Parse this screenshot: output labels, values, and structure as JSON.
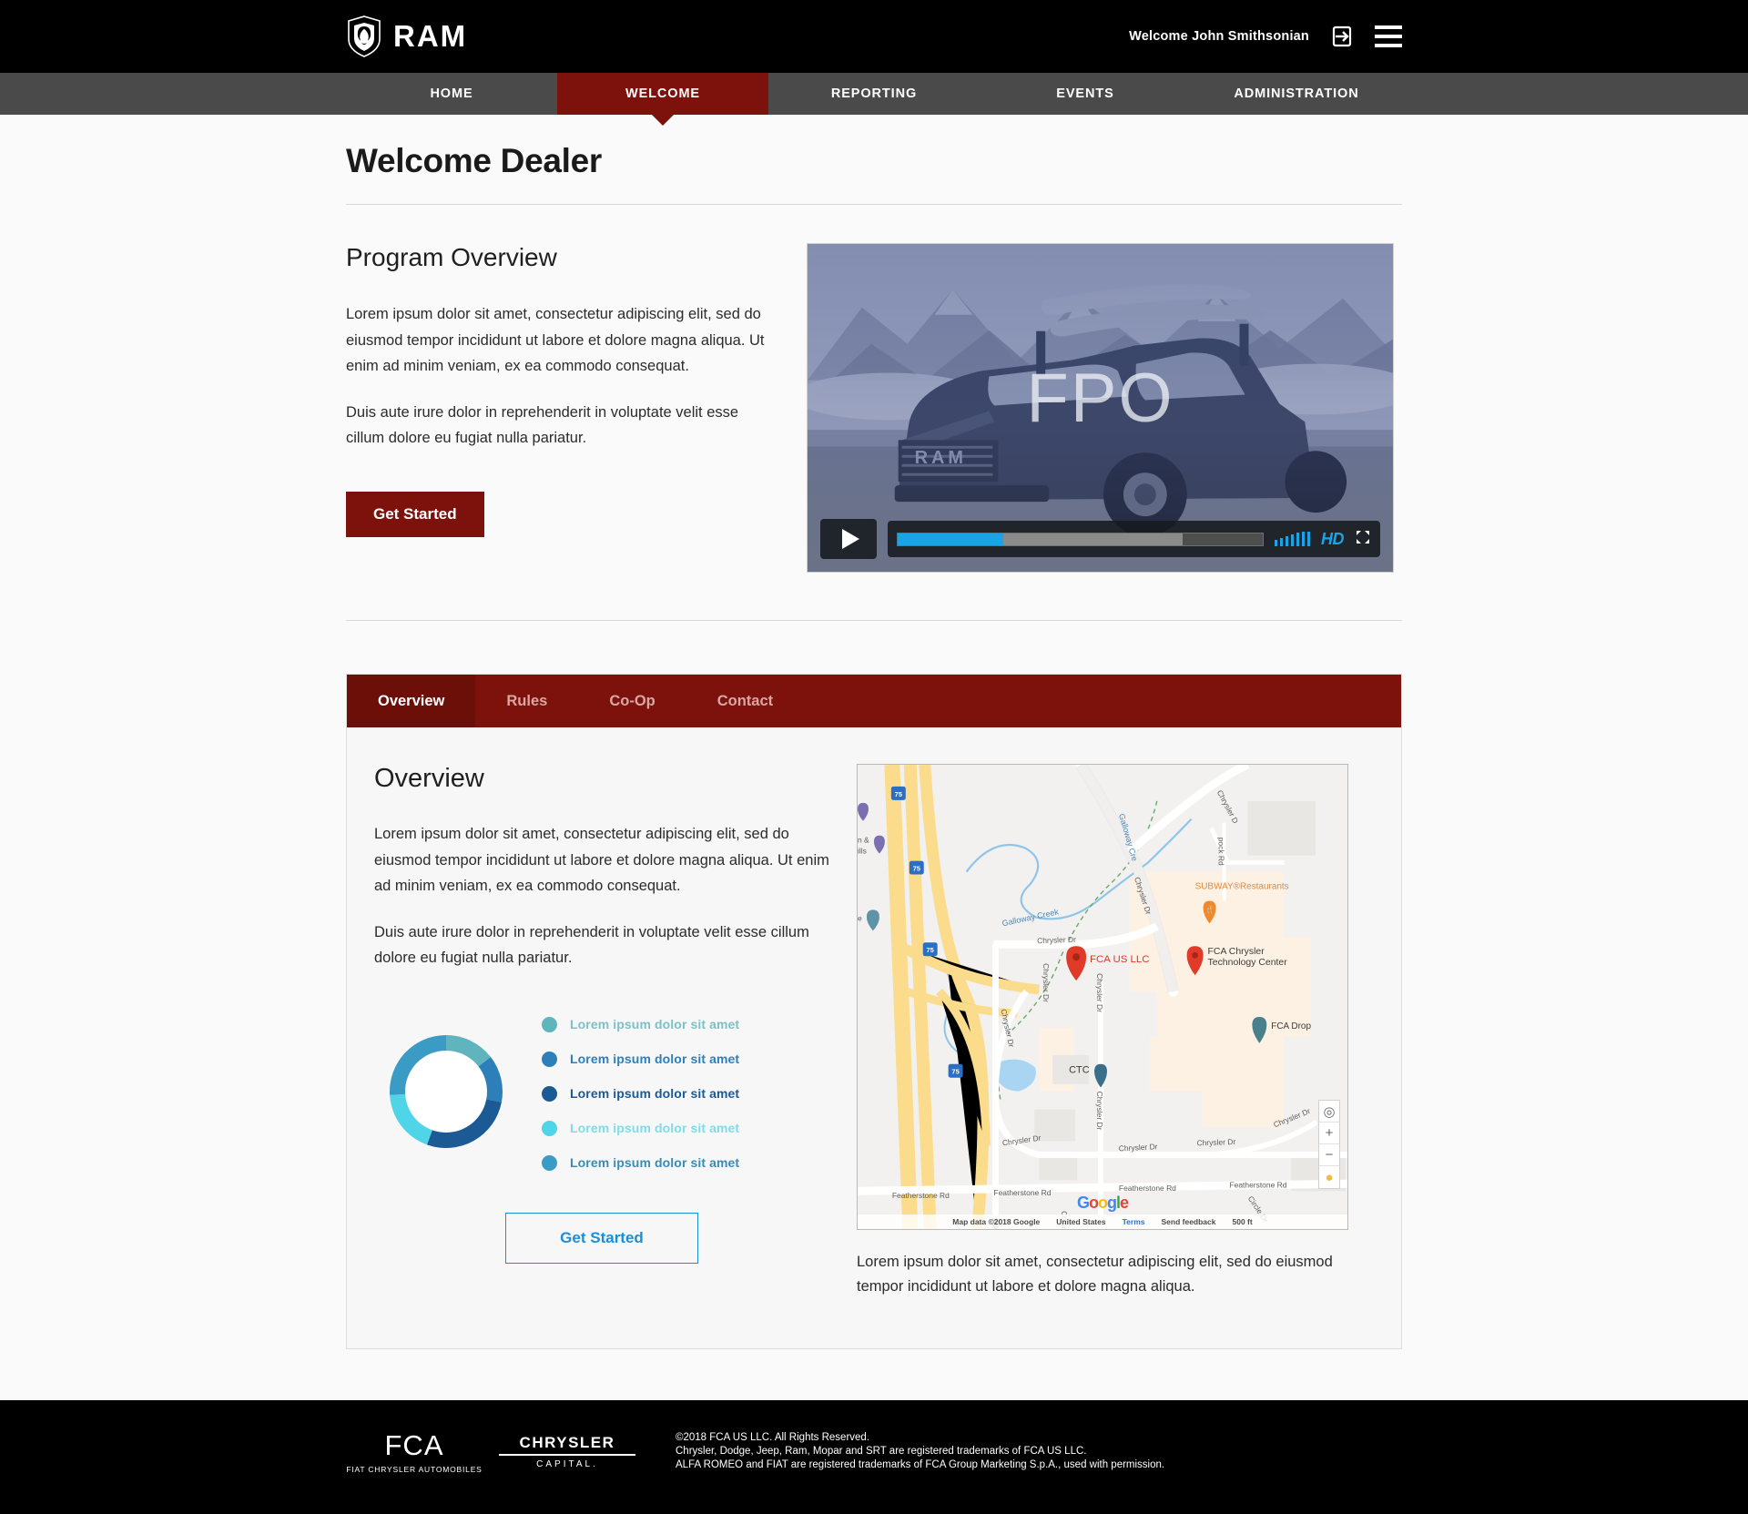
{
  "header": {
    "brand_name": "RAM",
    "brand_icon": "ram-head-shield-icon",
    "welcome_user": "Welcome John Smithsonian",
    "logout_icon": "logout-icon",
    "menu_icon": "hamburger-menu-icon"
  },
  "nav": {
    "items": [
      {
        "label": "HOME",
        "active": false
      },
      {
        "label": "WELCOME",
        "active": true
      },
      {
        "label": "REPORTING",
        "active": false
      },
      {
        "label": "EVENTS",
        "active": false
      },
      {
        "label": "ADMINISTRATION",
        "active": false
      }
    ]
  },
  "page": {
    "title": "Welcome Dealer"
  },
  "program": {
    "heading": "Program Overview",
    "paragraph1": "Lorem ipsum dolor sit amet, consectetur adipiscing elit, sed do eiusmod tempor incididunt ut labore et dolore magna aliqua. Ut enim ad minim veniam, ex ea commodo consequat.",
    "paragraph2": "Duis aute irure dolor in reprehenderit in voluptate velit esse cillum dolore eu fugiat nulla pariatur.",
    "cta_label": "Get Started"
  },
  "video": {
    "placeholder_text": "FPO",
    "play_icon": "play-icon",
    "quality_label": "HD",
    "fullscreen_icon": "fullscreen-icon",
    "volume_icon": "volume-bars-icon",
    "progress_percent": 29,
    "buffered_percent": 78,
    "accent_color": "#1ba3e8"
  },
  "panel": {
    "tabs": [
      {
        "label": "Overview",
        "active": true
      },
      {
        "label": "Rules",
        "active": false
      },
      {
        "label": "Co-Op",
        "active": false
      },
      {
        "label": "Contact",
        "active": false
      }
    ],
    "heading": "Overview",
    "paragraph1": "Lorem ipsum dolor sit amet, consectetur adipiscing elit, sed do eiusmod tempor incididunt ut labore et dolore magna aliqua. Ut enim ad minim veniam, ex ea commodo consequat.",
    "paragraph2": "Duis aute irure dolor in reprehenderit in voluptate velit esse cillum dolore eu fugiat nulla pariatur.",
    "cta_label": "Get Started",
    "map_caption": "Lorem ipsum dolor sit amet, consectetur adipiscing elit, sed do eiusmod tempor incididunt ut labore et dolore magna aliqua."
  },
  "chart_data": {
    "type": "pie",
    "title": "",
    "variant": "donut",
    "categories": [
      "Lorem ipsum dolor sit amet",
      "Lorem ipsum dolor sit amet",
      "Lorem ipsum dolor sit amet",
      "Lorem ipsum dolor sit amet",
      "Lorem ipsum dolor sit amet"
    ],
    "values": [
      14.5,
      13.5,
      27.5,
      18.5,
      26.0
    ],
    "colors": [
      "#5fb4bd",
      "#2c7fb8",
      "#1b5a94",
      "#4fd4e8",
      "#3a9cc4"
    ],
    "legend_position": "right",
    "legend": [
      {
        "label": "Lorem ipsum dolor sit amet",
        "color": "#5fb4bd",
        "value": 14.5
      },
      {
        "label": "Lorem ipsum dolor sit amet",
        "color": "#2c7fb8",
        "value": 13.5
      },
      {
        "label": "Lorem ipsum dolor sit amet",
        "color": "#1b5a94",
        "value": 27.5
      },
      {
        "label": "Lorem ipsum dolor sit amet",
        "color": "#4fd4e8",
        "value": 18.5
      },
      {
        "label": "Lorem ipsum dolor sit amet",
        "color": "#3a9cc4",
        "value": 26.0
      }
    ]
  },
  "map": {
    "markers": [
      {
        "label": "FCA US LLC",
        "color": "#e03a28"
      },
      {
        "label": "FCA Chrysler Technology Center",
        "color": "#e03a28"
      },
      {
        "label": "SUBWAY®Restaurants",
        "color": "#f0892a"
      },
      {
        "label": "FCA Drop",
        "color": "#4a7f8c"
      },
      {
        "label": "CTC",
        "color": "#3a6f8a"
      }
    ],
    "road_labels": [
      "Chrysler Dr",
      "Chrysler Dr",
      "Chrysler Dr",
      "Chrysler Dr",
      "Chrysler Dr",
      "Chrysler Dr",
      "Chrysler Dr",
      "Chrysler Dr",
      "Featherstone Rd",
      "Featherstone Rd",
      "Featherstone Rd",
      "Featherstone Rd",
      "Galloway Creek",
      "Galloway Cre",
      "pock Rd"
    ],
    "highway_shields": [
      "75",
      "75",
      "75",
      "75"
    ],
    "brand_letters": [
      "G",
      "o",
      "o",
      "g",
      "l",
      "e"
    ],
    "attribution": {
      "data": "Map data ©2018 Google",
      "region": "United States",
      "terms": "Terms",
      "feedback": "Send feedback",
      "scale": "500 ft"
    },
    "controls": {
      "locate_icon": "locate-me-icon",
      "zoom_in": "+",
      "zoom_out": "−",
      "street_view_icon": "pegman-icon"
    }
  },
  "footer": {
    "fca_word": "FCA",
    "fca_sub": "FIAT CHRYSLER AUTOMOBILES",
    "chrysler_word": "CHRYSLER",
    "chrysler_sub": "CAPITAL.",
    "legal_line1": "©2018 FCA US LLC. All Rights Reserved.",
    "legal_line2": "Chrysler, Dodge, Jeep, Ram, Mopar and SRT are registered trademarks of FCA US LLC.",
    "legal_line3": "ALFA ROMEO and FIAT are registered trademarks of FCA Group Marketing S.p.A., used with permission."
  }
}
